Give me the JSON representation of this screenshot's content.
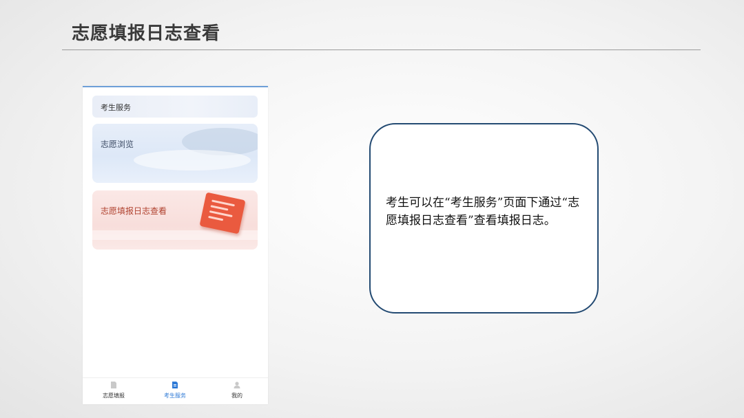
{
  "slide": {
    "title": "志愿填报日志查看"
  },
  "phone": {
    "section_header": "考生服务",
    "cards": [
      {
        "label": "志愿浏览"
      },
      {
        "label": "志愿填报日志查看"
      }
    ],
    "bottom_nav": [
      {
        "label": "志愿填报",
        "icon": "document-icon",
        "active": false
      },
      {
        "label": "考生服务",
        "icon": "service-doc-icon",
        "active": true
      },
      {
        "label": "我的",
        "icon": "user-icon",
        "active": false
      }
    ]
  },
  "callout": {
    "text": "考生可以在“考生服务”页面下通过“志愿填报日志查看”查看填报日志。"
  },
  "colors": {
    "accent_blue": "#2f7ad6",
    "callout_border": "#234a72",
    "log_card_accent": "#ea5a3f"
  }
}
